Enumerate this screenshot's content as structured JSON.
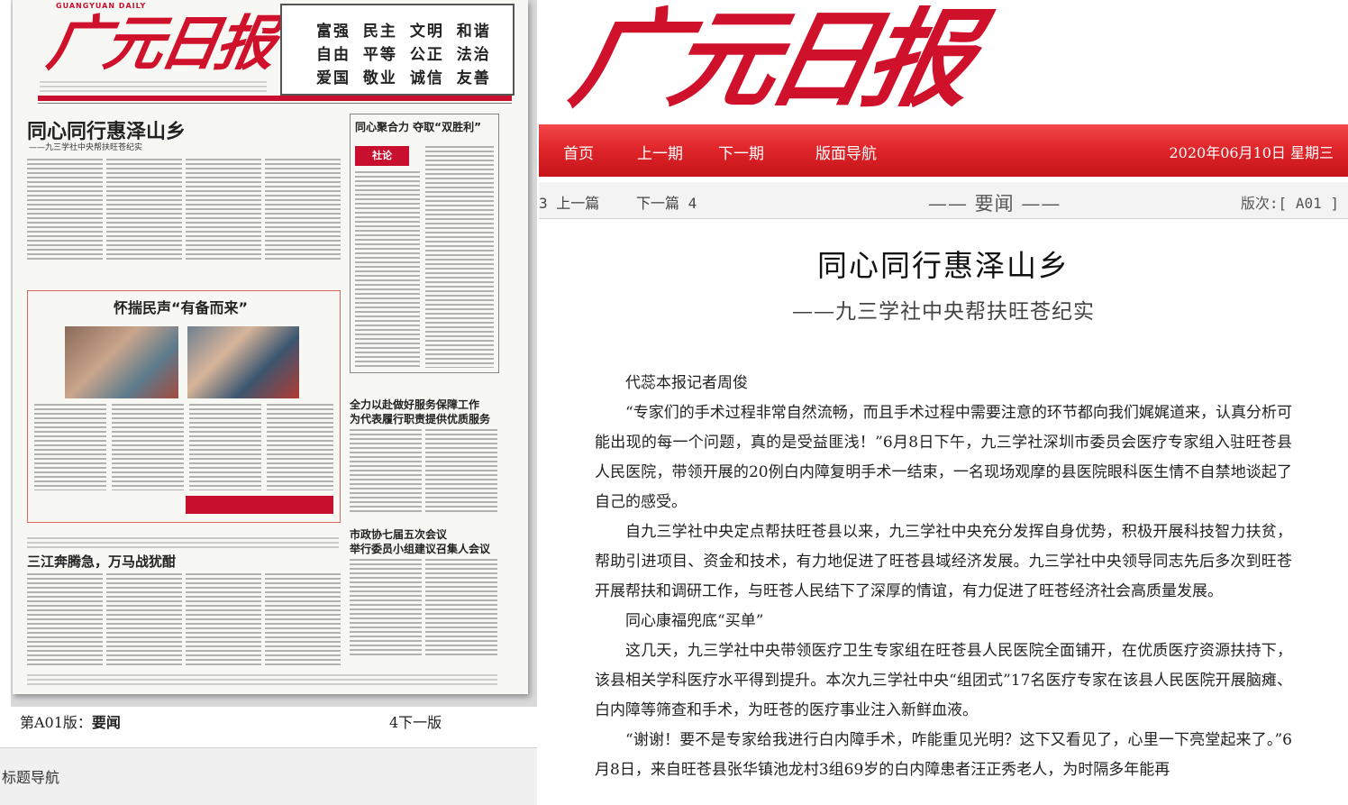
{
  "thumbnail": {
    "masthead_en": "GUANGYUAN DAILY",
    "masthead_cn": "广元日报",
    "core_values": [
      "富强 民主 文明 和谐",
      "自由 平等 公正 法治",
      "爱国 敬业 诚信 友善"
    ],
    "lead_headline": "同心同行惠泽山乡",
    "lead_sub": "——九三学社中央帮扶旺苍纪实",
    "side_headline": "同心聚合力 夺取“双胜利”",
    "side_badge": "社论",
    "box_headline": "怀揣民声“有备而来”",
    "right_headline_1": "全力以赴做好服务保障工作",
    "right_headline_2": "为代表履行职责提供优质服务",
    "bottom_headline": "三江奔腾急，万马战犹酣",
    "right_headline_3": "市政协七届五次会议",
    "right_headline_4": "举行委员小组建议召集人会议"
  },
  "caption": {
    "page_label": "第A01版：",
    "page_name": "要闻",
    "next_page": "4下一版"
  },
  "title_nav": "标题导航",
  "logo": "广元日报",
  "nav": {
    "items": [
      "首页",
      "上一期",
      "下一期",
      "版面导航"
    ],
    "date": "2020年06月10日 星期三"
  },
  "subnav": {
    "prev": "3 上一篇",
    "next": "下一篇 4",
    "section": "—— 要闻 ——",
    "page": "版次:[ A01 ]"
  },
  "article": {
    "title": "同心同行惠泽山乡",
    "subtitle": "——九三学社中央帮扶旺苍纪实",
    "paragraphs": [
      "代蕊本报记者周俊",
      "“专家们的手术过程非常自然流畅，而且手术过程中需要注意的环节都向我们娓娓道来，认真分析可能出现的每一个问题，真的是受益匪浅！”6月8日下午，九三学社深圳市委员会医疗专家组入驻旺苍县人民医院，带领开展的20例白内障复明手术一结束，一名现场观摩的县医院眼科医生情不自禁地谈起了自己的感受。",
      "自九三学社中央定点帮扶旺苍县以来，九三学社中央充分发挥自身优势，积极开展科技智力扶贫，帮助引进项目、资金和技术，有力地促进了旺苍县域经济发展。九三学社中央领导同志先后多次到旺苍开展帮扶和调研工作，与旺苍人民结下了深厚的情谊，有力促进了旺苍经济社会高质量发展。",
      "同心康福兜底“买单”",
      "这几天，九三学社中央带领医疗卫生专家组在旺苍县人民医院全面铺开，在优质医疗资源扶持下，该县相关学科医疗水平得到提升。本次九三学社中央“组团式”17名医疗专家在该县人民医院开展脑瘫、白内障等筛查和手术，为旺苍的医疗事业注入新鲜血液。",
      "“谢谢！要不是专家给我进行白内障手术，咋能重见光明？这下又看见了，心里一下亮堂起来了。”6月8日，来自旺苍县张华镇池龙村3组69岁的白内障患者汪正秀老人，为时隔多年能再"
    ]
  },
  "colors": {
    "brand_red": "#d0112b",
    "nav_red": "#e0262b"
  }
}
